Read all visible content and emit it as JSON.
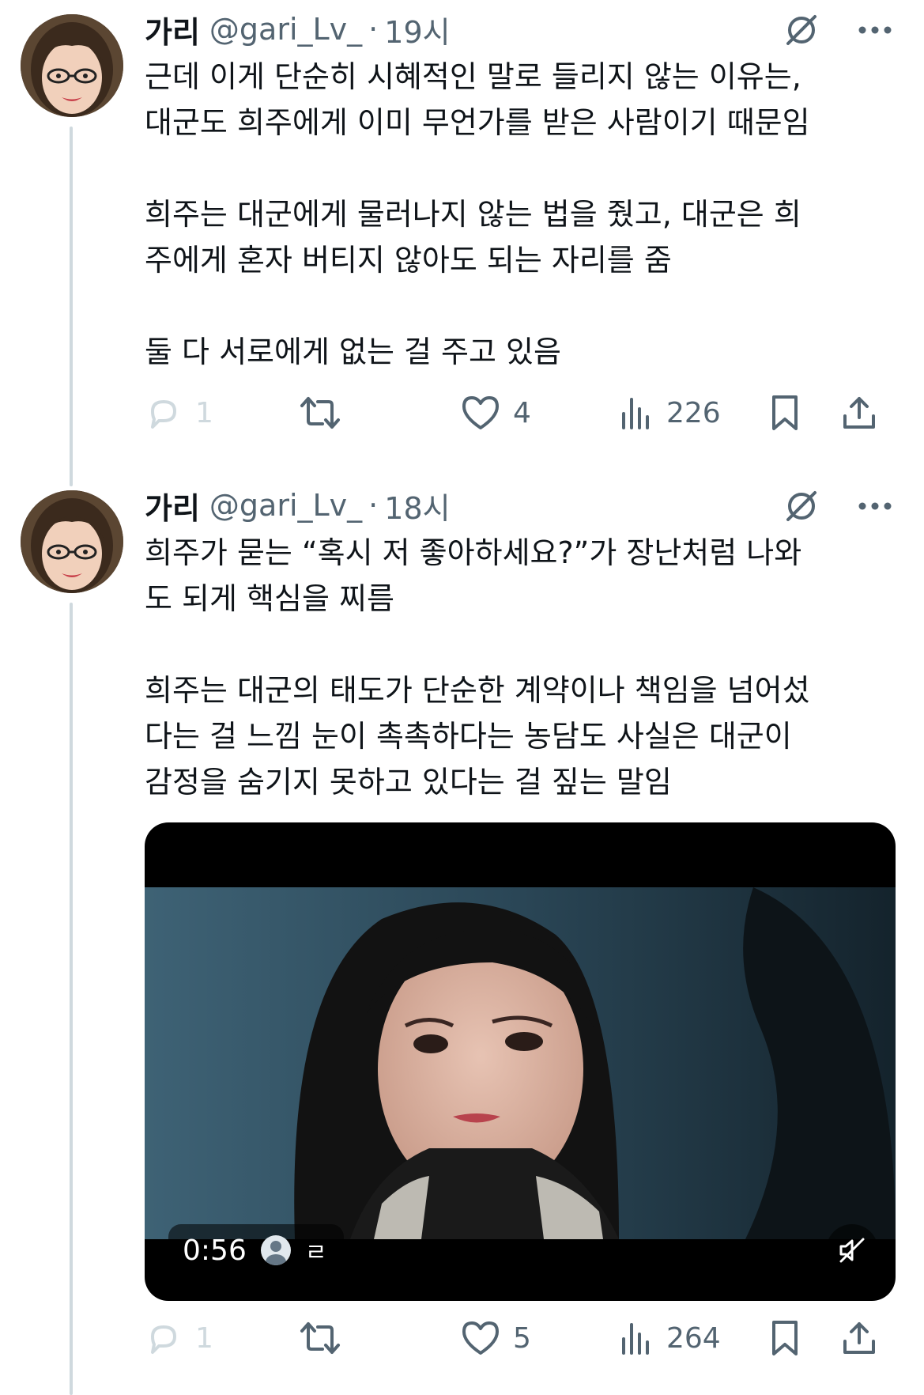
{
  "tweets": [
    {
      "author_name": "가리",
      "handle": "@gari_Lv_",
      "separator": "·",
      "time": "19시",
      "text": "근데 이게 단순히 시혜적인 말로 들리지 않는 이유는,\n대군도 희주에게 이미 무언가를 받은 사람이기 때문임\n\n희주는 대군에게 물러나지 않는 법을 줬고, 대군은 희\n주에게 혼자 버티지 않아도 되는 자리를 줌\n\n둘 다 서로에게 없는 걸 주고 있음",
      "reply_count": "1",
      "retweet_count": "",
      "like_count": "4",
      "view_count": "226"
    },
    {
      "author_name": "가리",
      "handle": "@gari_Lv_",
      "separator": "·",
      "time": "18시",
      "text": "희주가 묻는 “혹시 저 좋아하세요?”가 장난처럼 나와\n도 되게 핵심을 찌름\n\n희주는 대군의 태도가 단순한 계약이나 책임을 넘어섰\n다는 걸 느낌 눈이 촉촉하다는 농담도 사실은 대군이\n감정을 숨기지 못하고 있다는 걸 짚는 말임",
      "video": {
        "duration": "0:56",
        "badge_text": "ㄹ"
      },
      "reply_count": "1",
      "retweet_count": "",
      "like_count": "5",
      "view_count": "264"
    }
  ],
  "colors": {
    "text": "#0f1419",
    "secondary": "#536471",
    "thread_line": "#cfd9de"
  },
  "icons": [
    "grok-icon",
    "more-icon",
    "reply-icon",
    "retweet-icon",
    "like-icon",
    "views-icon",
    "bookmark-icon",
    "share-icon",
    "mute-icon"
  ]
}
